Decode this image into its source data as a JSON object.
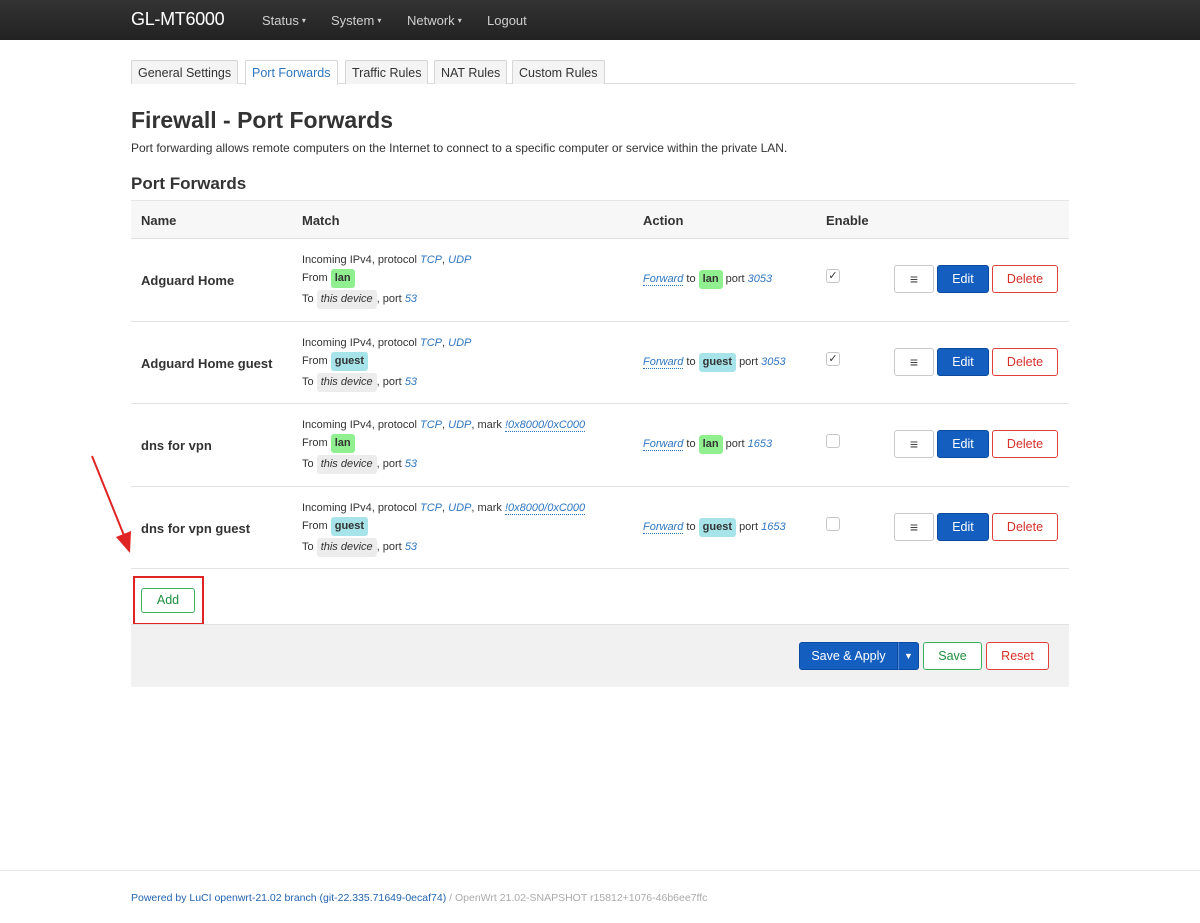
{
  "navbar": {
    "brand": "GL-MT6000",
    "menus": [
      "Status",
      "System",
      "Network"
    ],
    "logout": "Logout",
    "caret": "▾"
  },
  "tabs": [
    "General Settings",
    "Port Forwards",
    "Traffic Rules",
    "NAT Rules",
    "Custom Rules"
  ],
  "active_tab": "Port Forwards",
  "page": {
    "title": "Firewall - Port Forwards",
    "description": "Port forwarding allows remote computers on the Internet to connect to a specific computer or service within the private LAN.",
    "section_title": "Port Forwards"
  },
  "table": {
    "headers": {
      "name": "Name",
      "match": "Match",
      "action": "Action",
      "enable": "Enable"
    },
    "rows": [
      {
        "name": "Adguard Home",
        "match_prefix": "Incoming IPv4, protocol ",
        "proto1": "TCP",
        "proto2": "UDP",
        "mark_text": "",
        "mark": "",
        "from_label": "From",
        "from_zone": "lan",
        "to_label": "To",
        "to_dev": "this device",
        "port_label": ", port",
        "port": "53",
        "forward": "Forward",
        "to_word": "to",
        "dest_zone": "lan",
        "dest_port_label": "port",
        "dest_port": "3053",
        "enabled": "✓"
      },
      {
        "name": "Adguard Home guest",
        "match_prefix": "Incoming IPv4, protocol ",
        "proto1": "TCP",
        "proto2": "UDP",
        "mark_text": "",
        "mark": "",
        "from_label": "From",
        "from_zone": "guest",
        "to_label": "To",
        "to_dev": "this device",
        "port_label": ", port",
        "port": "53",
        "forward": "Forward",
        "to_word": "to",
        "dest_zone": "guest",
        "dest_port_label": "port",
        "dest_port": "3053",
        "enabled": "✓"
      },
      {
        "name": "dns for vpn",
        "match_prefix": "Incoming IPv4, protocol ",
        "proto1": "TCP",
        "proto2": "UDP",
        "mark_text": ", mark ",
        "mark": "!0x8000/0xC000",
        "from_label": "From",
        "from_zone": "lan",
        "to_label": "To",
        "to_dev": "this device",
        "port_label": ", port",
        "port": "53",
        "forward": "Forward",
        "to_word": "to",
        "dest_zone": "lan",
        "dest_port_label": "port",
        "dest_port": "1653",
        "enabled": ""
      },
      {
        "name": "dns for vpn guest",
        "match_prefix": "Incoming IPv4, protocol ",
        "proto1": "TCP",
        "proto2": "UDP",
        "mark_text": ", mark ",
        "mark": "!0x8000/0xC000",
        "from_label": "From",
        "from_zone": "guest",
        "to_label": "To",
        "to_dev": "this device",
        "port_label": ", port",
        "port": "53",
        "forward": "Forward",
        "to_word": "to",
        "dest_zone": "guest",
        "dest_port_label": "port",
        "dest_port": "1653",
        "enabled": ""
      }
    ],
    "row_buttons": {
      "menu": "≡",
      "edit": "Edit",
      "delete": "Delete"
    }
  },
  "buttons": {
    "add": "Add",
    "save_apply": "Save & Apply",
    "save_apply_dropdown": "▼",
    "save": "Save",
    "reset": "Reset"
  },
  "footer": {
    "powered": "Powered by LuCI openwrt-21.02 branch (git-22.335.71649-0ecaf74)",
    "separator": " / ",
    "version": "OpenWrt 21.02-SNAPSHOT r15812+1076-46b6ee7ffc"
  },
  "colors": {
    "navbar": "#262626",
    "primary": "#135ebf",
    "positive": "#3cb05c",
    "negative": "#e0403a",
    "zone_lan": "#90f090",
    "zone_guest": "#a6e4ea",
    "annotation": "#e02424"
  }
}
